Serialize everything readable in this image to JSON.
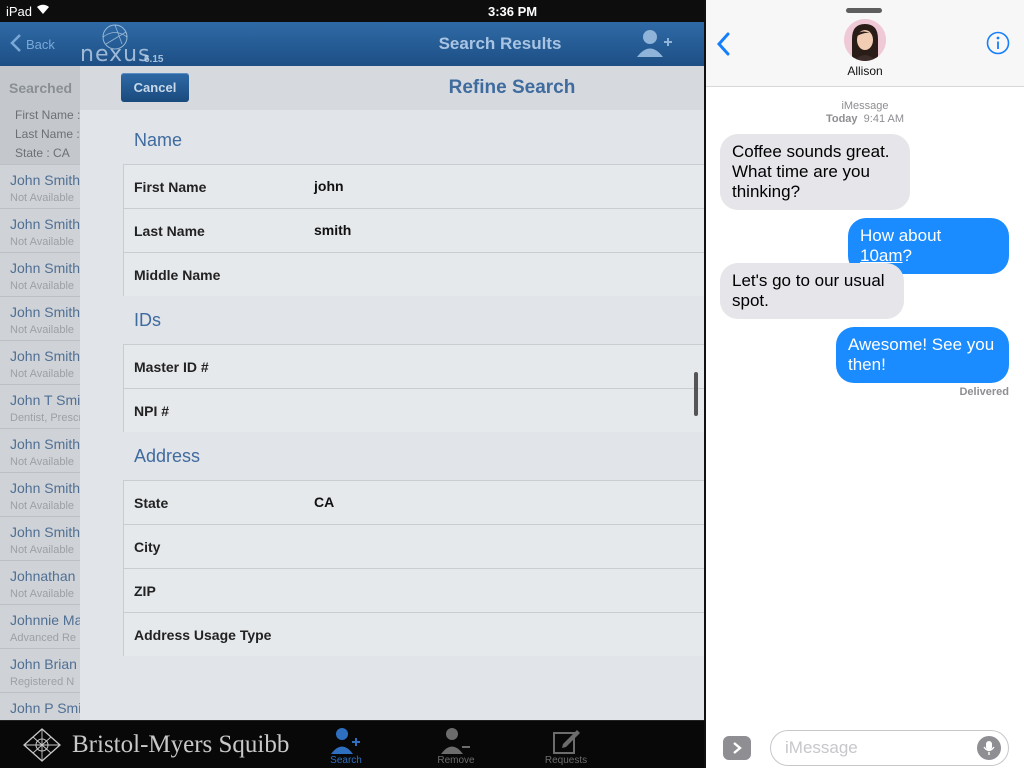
{
  "status": {
    "carrier": "iPad",
    "time": "3:36 PM"
  },
  "nexus": {
    "back_label": "Back",
    "logo_word": "nexus",
    "version": "6.15",
    "title": "Search Results",
    "results_header": "Searched",
    "criteria": [
      "First Name :",
      "Last Name :",
      "State : CA"
    ],
    "results": [
      {
        "name": "John Smith",
        "sub": "Not Available"
      },
      {
        "name": "John Smith",
        "sub": "Not Available"
      },
      {
        "name": "John Smith",
        "sub": "Not Available"
      },
      {
        "name": "John Smith",
        "sub": "Not Available"
      },
      {
        "name": "John Smith",
        "sub": "Not Available"
      },
      {
        "name": "John T Smith",
        "sub": "Dentist, Prescriber"
      },
      {
        "name": "John Smith",
        "sub": "Not Available"
      },
      {
        "name": "John Smith",
        "sub": "Not Available"
      },
      {
        "name": "John Smith",
        "sub": "Not Available"
      },
      {
        "name": "Johnathan",
        "sub": "Not Available"
      },
      {
        "name": "Johnnie Ma",
        "sub": "Advanced Re"
      },
      {
        "name": "John Brian",
        "sub": "Registered N"
      },
      {
        "name": "John P Smi",
        "sub": ""
      }
    ],
    "modal": {
      "cancel_label": "Cancel",
      "title": "Refine Search",
      "sections": {
        "name": "Name",
        "ids": "IDs",
        "address": "Address"
      },
      "fields": {
        "first_name": {
          "label": "First Name",
          "value": "john"
        },
        "last_name": {
          "label": "Last Name",
          "value": "smith"
        },
        "middle_name": {
          "label": "Middle Name",
          "value": ""
        },
        "master_id": {
          "label": "Master ID #",
          "value": ""
        },
        "npi": {
          "label": "NPI #",
          "value": ""
        },
        "state": {
          "label": "State",
          "value": "CA"
        },
        "city": {
          "label": "City",
          "value": ""
        },
        "zip": {
          "label": "ZIP",
          "value": ""
        },
        "address_usage": {
          "label": "Address Usage Type",
          "value": ""
        }
      }
    },
    "brand": "Bristol-Myers Squibb",
    "tabs": [
      {
        "label": "Search",
        "icon": "search-person-icon",
        "active": true
      },
      {
        "label": "Remove",
        "icon": "remove-person-icon",
        "active": false
      },
      {
        "label": "Requests",
        "icon": "compose-icon",
        "active": false
      }
    ]
  },
  "messages": {
    "contact": "Allison",
    "service": "iMessage",
    "day": "Today",
    "time": "9:41 AM",
    "thread": [
      {
        "dir": "in",
        "text": "Coffee sounds great. What time are you thinking?"
      },
      {
        "dir": "out",
        "text_before": "How about ",
        "link": "10am",
        "text_after": "?"
      },
      {
        "dir": "in",
        "text": "Let's go to our usual spot."
      },
      {
        "dir": "out",
        "text": "Awesome! See you then!"
      }
    ],
    "delivered": "Delivered",
    "input_placeholder": "iMessage",
    "colors": {
      "outgoing": "#1a8cff",
      "incoming": "#e5e5ea",
      "tint": "#157efb"
    }
  }
}
